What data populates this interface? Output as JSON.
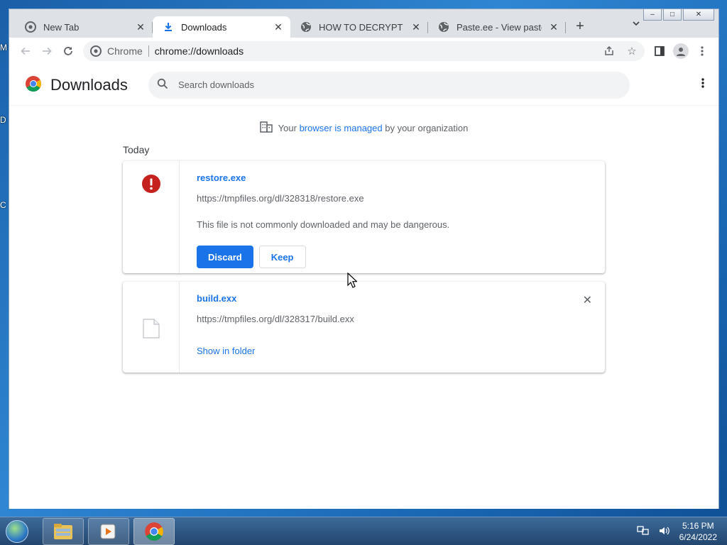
{
  "desktop": {
    "labels": [
      "M",
      "D",
      "C"
    ]
  },
  "window": {
    "controls": {
      "minimize": "–",
      "maximize": "□",
      "close": "✕"
    }
  },
  "tabs": [
    {
      "title": "New Tab",
      "icon": "chrome-icon",
      "active": false
    },
    {
      "title": "Downloads",
      "icon": "download-icon",
      "active": true
    },
    {
      "title": "HOW TO DECRYPT YOUR",
      "icon": "globe-icon",
      "active": false
    },
    {
      "title": "Paste.ee - View paste Lm",
      "icon": "globe-icon",
      "active": false
    }
  ],
  "toolbar": {
    "chip": "Chrome",
    "url": "chrome://downloads"
  },
  "downloads": {
    "title": "Downloads",
    "search_placeholder": "Search downloads",
    "managed_prefix": "Your ",
    "managed_link": "browser is managed",
    "managed_suffix": " by your organization",
    "section": "Today",
    "items": [
      {
        "name": "restore.exe",
        "url": "https://tmpfiles.org/dl/328318/restore.exe",
        "warning": "This file is not commonly downloaded and may be dangerous.",
        "discard_label": "Discard",
        "keep_label": "Keep"
      },
      {
        "name": "build.exx",
        "url": "https://tmpfiles.org/dl/328317/build.exx",
        "link": "Show in folder"
      }
    ]
  },
  "taskbar": {
    "time": "5:16 PM",
    "date": "6/24/2022"
  },
  "colors": {
    "accent": "#1a73e8",
    "danger": "#c5221f"
  }
}
